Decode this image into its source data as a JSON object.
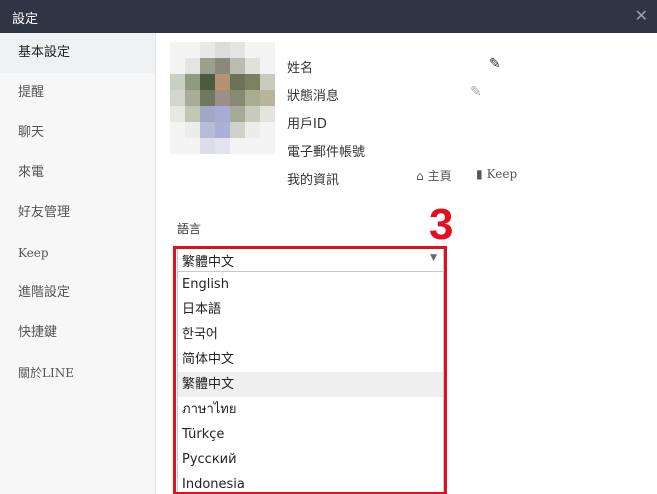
{
  "window": {
    "title": "設定",
    "close_glyph": "✕"
  },
  "sidebar": {
    "items": [
      {
        "label": "基本設定",
        "active": true
      },
      {
        "label": "提醒"
      },
      {
        "label": "聊天"
      },
      {
        "label": "來電"
      },
      {
        "label": "好友管理"
      },
      {
        "label": "Keep"
      },
      {
        "label": "進階設定"
      },
      {
        "label": "快捷鍵"
      },
      {
        "label": "關於LINE"
      }
    ]
  },
  "profile": {
    "name_label": "姓名",
    "status_label": "狀態消息",
    "userid_label": "用戶ID",
    "email_label": "電子郵件帳號",
    "myinfo_label": "我的資訊",
    "home_link": "主頁",
    "keep_link": "Keep",
    "edit_icon": "pencil-icon"
  },
  "language": {
    "label": "語言",
    "selected": "繁體中文",
    "options": [
      "English",
      "日本語",
      "한국어",
      "简体中文",
      "繁體中文",
      "ภาษาไทย",
      "Türkçe",
      "Русский",
      "Indonesia"
    ]
  },
  "annotation": {
    "step": "3",
    "color": "#e01020"
  },
  "colors": {
    "titlebar": "#2f3542",
    "sidebar_bg": "#f7f7f7",
    "active_bg": "#eef0f2"
  }
}
